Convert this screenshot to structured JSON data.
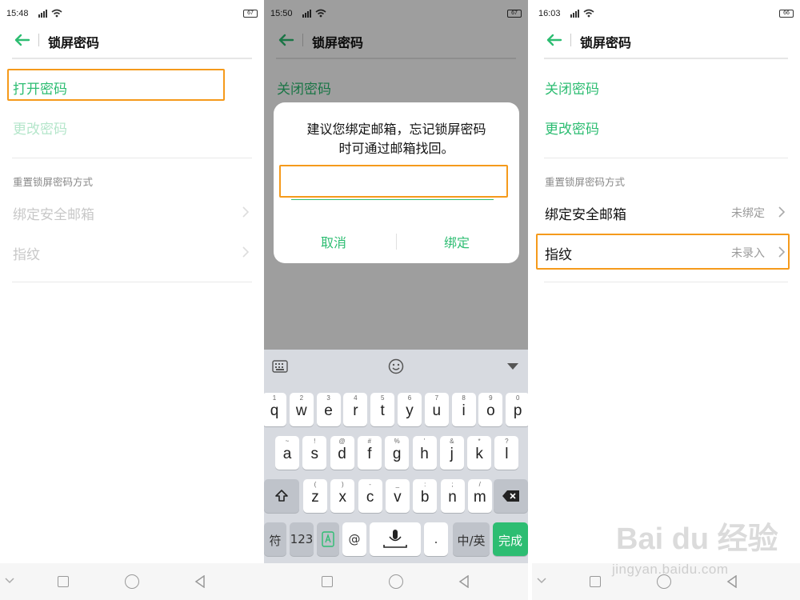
{
  "panels": [
    {
      "status": {
        "time": "15:48",
        "battery": "67"
      },
      "title": "锁屏密码",
      "toggle_label": "打开密码",
      "change_label": "更改密码",
      "section_label": "重置锁屏密码方式",
      "email_label": "绑定安全邮箱",
      "fingerprint_label": "指纹"
    },
    {
      "status": {
        "time": "15:50",
        "battery": "67"
      },
      "title": "锁屏密码",
      "toggle_label": "关闭密码",
      "dialog": {
        "message_line1": "建议您绑定邮箱，忘记锁屏密码",
        "message_line2": "时可通过邮箱找回。",
        "input_value": "",
        "cancel_label": "取消",
        "bind_label": "绑定"
      },
      "keyboard": {
        "row1": [
          {
            "hint": "1",
            "key": "q"
          },
          {
            "hint": "2",
            "key": "w"
          },
          {
            "hint": "3",
            "key": "e"
          },
          {
            "hint": "4",
            "key": "r"
          },
          {
            "hint": "5",
            "key": "t"
          },
          {
            "hint": "6",
            "key": "y"
          },
          {
            "hint": "7",
            "key": "u"
          },
          {
            "hint": "8",
            "key": "i"
          },
          {
            "hint": "9",
            "key": "o"
          },
          {
            "hint": "0",
            "key": "p"
          }
        ],
        "row2": [
          {
            "hint": "~",
            "key": "a"
          },
          {
            "hint": "!",
            "key": "s"
          },
          {
            "hint": "@",
            "key": "d"
          },
          {
            "hint": "#",
            "key": "f"
          },
          {
            "hint": "%",
            "key": "g"
          },
          {
            "hint": "'",
            "key": "h"
          },
          {
            "hint": "&",
            "key": "j"
          },
          {
            "hint": "*",
            "key": "k"
          },
          {
            "hint": "?",
            "key": "l"
          }
        ],
        "row3": [
          {
            "hint": "(",
            "key": "z"
          },
          {
            "hint": ")",
            "key": "x"
          },
          {
            "hint": "-",
            "key": "c"
          },
          {
            "hint": "_",
            "key": "v"
          },
          {
            "hint": ":",
            "key": "b"
          },
          {
            "hint": ";",
            "key": "n"
          },
          {
            "hint": "/",
            "key": "m"
          }
        ],
        "symbol_label": "符",
        "num_label": "123",
        "at_label": "@",
        "dot_label": ".",
        "lang_label": "中/英",
        "done_label": "完成"
      }
    },
    {
      "status": {
        "time": "16:03",
        "battery": "66"
      },
      "title": "锁屏密码",
      "toggle_label": "关闭密码",
      "change_label": "更改密码",
      "section_label": "重置锁屏密码方式",
      "email_label": "绑定安全邮箱",
      "email_value": "未绑定",
      "fingerprint_label": "指纹",
      "fingerprint_value": "未录入"
    }
  ],
  "watermark": {
    "logo": "Bai du 经验",
    "url": "jingyan.baidu.com"
  },
  "colors": {
    "accent": "#2dbd72",
    "highlight": "#f59a1b"
  }
}
